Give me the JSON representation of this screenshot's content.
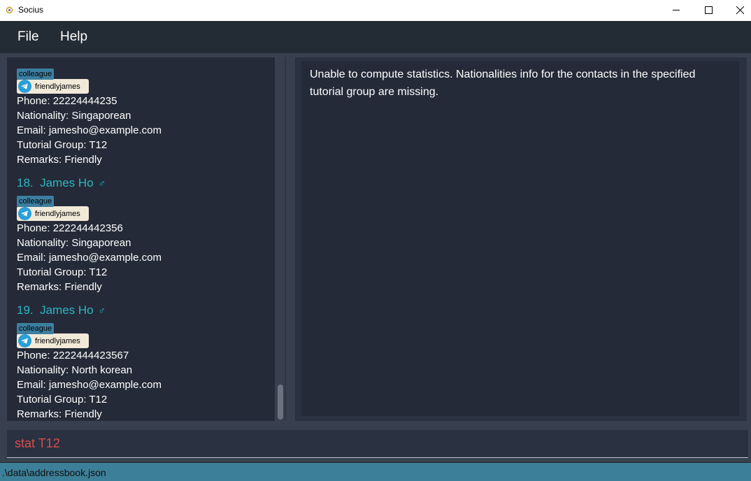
{
  "window": {
    "title": "Socius"
  },
  "menu": {
    "file": "File",
    "help": "Help"
  },
  "contacts": [
    {
      "index": "",
      "name": "",
      "gender_icon": "male-symbol",
      "tag": "colleague",
      "telegram": "friendlyjames",
      "phone": "Phone: 22224444235",
      "nationality": "Nationality: Singaporean",
      "email": "Email: jamesho@example.com",
      "tutorial": "Tutorial Group: T12",
      "remarks": "Remarks: Friendly"
    },
    {
      "index": "18.",
      "name": "James Ho",
      "gender": "♂",
      "tag": "colleague",
      "telegram": "friendlyjames",
      "phone": "Phone: 222244442356",
      "nationality": "Nationality: Singaporean",
      "email": "Email: jamesho@example.com",
      "tutorial": "Tutorial Group: T12",
      "remarks": "Remarks: Friendly"
    },
    {
      "index": "19.",
      "name": "James Ho",
      "gender": "♂",
      "tag": "colleague",
      "telegram": "friendlyjames",
      "phone": "Phone: 2222444423567",
      "nationality": "Nationality: North korean",
      "email": "Email: jamesho@example.com",
      "tutorial": "Tutorial Group: T12",
      "remarks": "Remarks: Friendly"
    }
  ],
  "result": {
    "message": "Unable to compute statistics. Nationalities info for the contacts in the specified tutorial group are missing."
  },
  "command": {
    "value": "stat T12"
  },
  "status": {
    "path": ".\\data\\addressbook.json"
  },
  "colors": {
    "accent": "#2ab7c4",
    "command_text": "#d94c4c",
    "status_bar": "#3c7f98"
  }
}
